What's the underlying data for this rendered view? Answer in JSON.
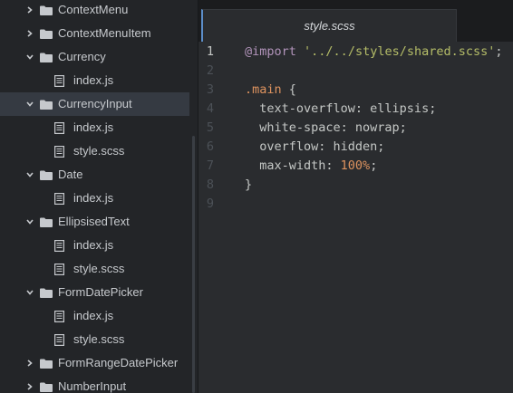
{
  "sidebar": {
    "items": [
      {
        "label": "ContextMenu",
        "kind": "folder",
        "state": "collapsed",
        "depth": 0
      },
      {
        "label": "ContextMenuItem",
        "kind": "folder",
        "state": "collapsed",
        "depth": 0
      },
      {
        "label": "Currency",
        "kind": "folder",
        "state": "expanded",
        "depth": 0
      },
      {
        "label": "index.js",
        "kind": "file",
        "depth": 1
      },
      {
        "label": "CurrencyInput",
        "kind": "folder",
        "state": "expanded",
        "depth": 0,
        "selected": true
      },
      {
        "label": "index.js",
        "kind": "file",
        "depth": 1
      },
      {
        "label": "style.scss",
        "kind": "file",
        "depth": 1
      },
      {
        "label": "Date",
        "kind": "folder",
        "state": "expanded",
        "depth": 0
      },
      {
        "label": "index.js",
        "kind": "file",
        "depth": 1
      },
      {
        "label": "EllipsisedText",
        "kind": "folder",
        "state": "expanded",
        "depth": 0
      },
      {
        "label": "index.js",
        "kind": "file",
        "depth": 1
      },
      {
        "label": "style.scss",
        "kind": "file",
        "depth": 1
      },
      {
        "label": "FormDatePicker",
        "kind": "folder",
        "state": "expanded",
        "depth": 0
      },
      {
        "label": "index.js",
        "kind": "file",
        "depth": 1
      },
      {
        "label": "style.scss",
        "kind": "file",
        "depth": 1
      },
      {
        "label": "FormRangeDatePicker",
        "kind": "folder",
        "state": "collapsed",
        "depth": 0
      },
      {
        "label": "NumberInput",
        "kind": "folder",
        "state": "collapsed",
        "depth": 0
      }
    ]
  },
  "tabs": [
    {
      "title": "style.scss",
      "active": true
    }
  ],
  "editor": {
    "current_line": 1,
    "lines": [
      {
        "num": "1",
        "tokens": [
          {
            "t": "@import",
            "c": "at"
          },
          {
            "t": " ",
            "c": "plain"
          },
          {
            "t": "'../../styles/shared.scss'",
            "c": "str"
          },
          {
            "t": ";",
            "c": "plain"
          }
        ]
      },
      {
        "num": "2",
        "tokens": []
      },
      {
        "num": "3",
        "tokens": [
          {
            "t": ".main",
            "c": "sel"
          },
          {
            "t": " {",
            "c": "plain"
          }
        ]
      },
      {
        "num": "4",
        "tokens": [
          {
            "t": "  text-overflow: ellipsis;",
            "c": "plain"
          }
        ]
      },
      {
        "num": "5",
        "tokens": [
          {
            "t": "  white-space: nowrap;",
            "c": "plain"
          }
        ]
      },
      {
        "num": "6",
        "tokens": [
          {
            "t": "  overflow: hidden;",
            "c": "plain"
          }
        ]
      },
      {
        "num": "7",
        "tokens": [
          {
            "t": "  max-width: ",
            "c": "plain"
          },
          {
            "t": "100%",
            "c": "num"
          },
          {
            "t": ";",
            "c": "plain"
          }
        ]
      },
      {
        "num": "8",
        "tokens": [
          {
            "t": "}",
            "c": "plain"
          }
        ]
      },
      {
        "num": "9",
        "tokens": []
      }
    ]
  },
  "theme": {
    "accent": "#5c8ec9",
    "keyword_color": "#b294bb",
    "string_color": "#b5bd68",
    "selector_color": "#de935f"
  }
}
